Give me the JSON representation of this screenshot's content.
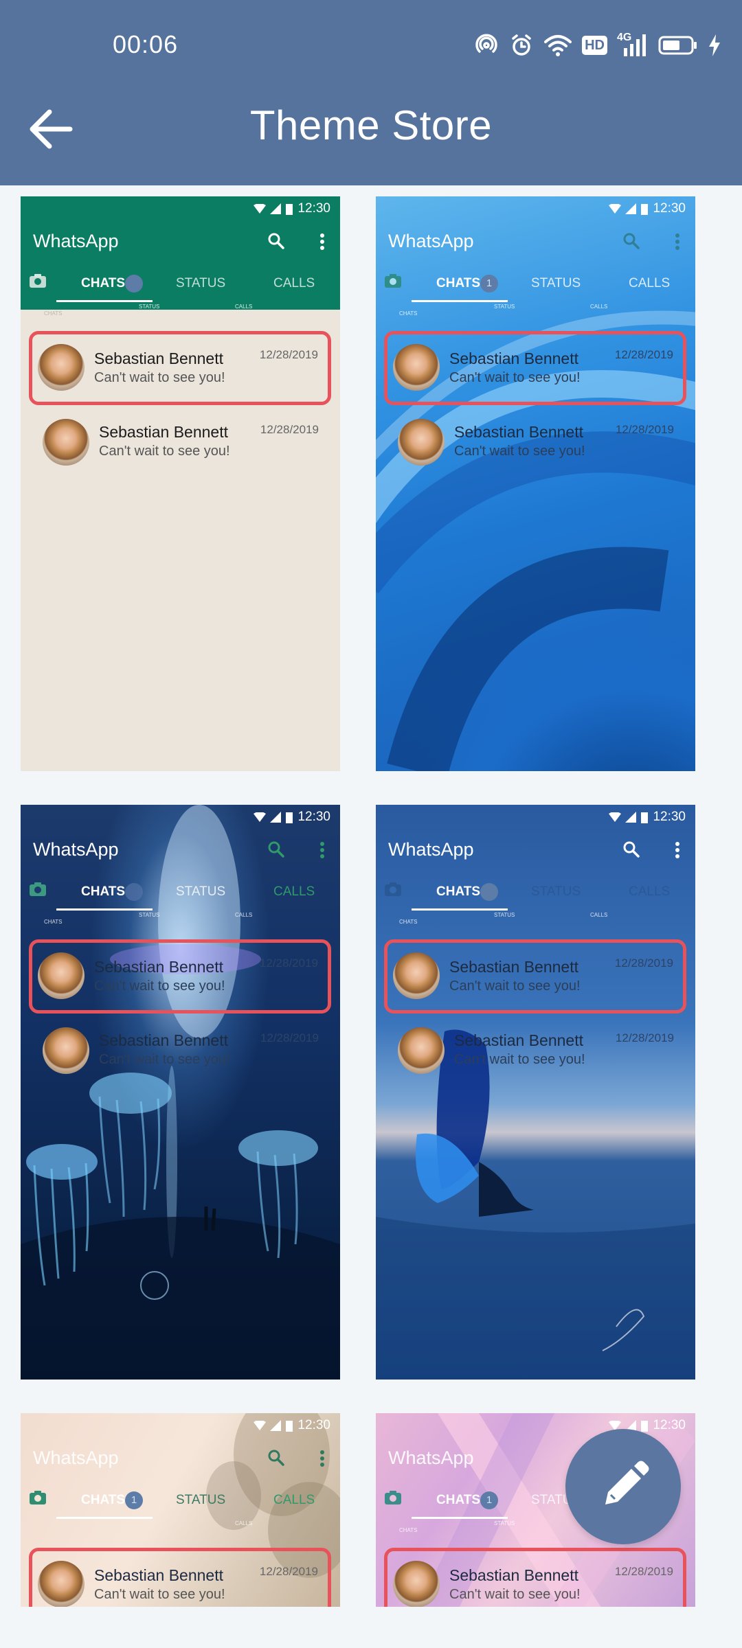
{
  "status_bar": {
    "time": "00:06",
    "hd_label": "HD",
    "network_label": "4G"
  },
  "appbar": {
    "title": "Theme Store"
  },
  "preview": {
    "status_time": "12:30",
    "app_name": "WhatsApp",
    "tabs": {
      "chats": "CHATS",
      "status": "STATUS",
      "calls": "CALLS"
    },
    "mini_labels": {
      "chats": "CHATS",
      "status": "STATUS",
      "calls": "CALLS"
    },
    "badge_count": "1",
    "contact_name": "Sebastian Bennett",
    "message": "Can't wait to see you!",
    "date": "12/28/2019"
  },
  "themes": [
    {
      "name": "classic-beige"
    },
    {
      "name": "blue-wave"
    },
    {
      "name": "jellyfish-night"
    },
    {
      "name": "butterfly-girl-sea"
    },
    {
      "name": "soft-blur-cream"
    },
    {
      "name": "pink-ribbon"
    }
  ],
  "colors": {
    "appbar": "#55739c",
    "highlight_border": "#e8525b",
    "fab": "#5a76a1",
    "whatsapp_green": "#0b7d62"
  }
}
